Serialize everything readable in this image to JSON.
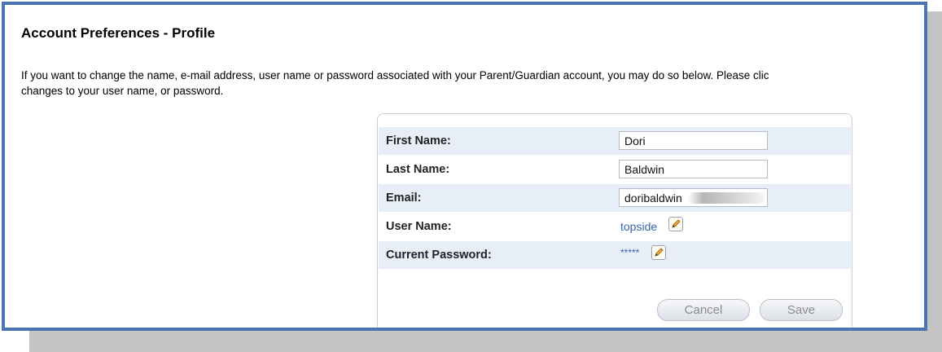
{
  "page": {
    "title": "Account Preferences - Profile",
    "intro_line1": "If you want to change the name, e-mail address, user name or password associated with your Parent/Guardian account, you may do so below. Please clic",
    "intro_line2": "changes to your user name, or password."
  },
  "form": {
    "first_name": {
      "label": "First Name:",
      "value": "Dori"
    },
    "last_name": {
      "label": "Last Name:",
      "value": "Baldwin"
    },
    "email": {
      "label": "Email:",
      "value": "doribaldwin"
    },
    "user_name": {
      "label": "User Name:",
      "value": "topside"
    },
    "password": {
      "label": "Current Password:",
      "value": "*****"
    }
  },
  "buttons": {
    "cancel": "Cancel",
    "save": "Save"
  },
  "icons": {
    "edit": "pencil-edit-icon"
  },
  "colors": {
    "frame_border": "#4b74b3",
    "row_alt": "#e8eef8",
    "link": "#3a63a8"
  }
}
